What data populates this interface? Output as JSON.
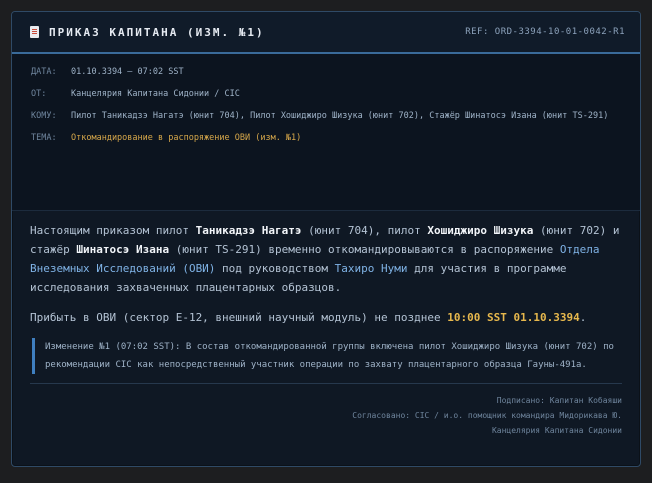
{
  "header": {
    "icon": "document-icon",
    "title": "ПРИКАЗ КАПИТАНА (ИЗМ. №1)",
    "ref": "REF: ORD-3394-10-01-0042-R1"
  },
  "meta": {
    "date_key": "ДАТА:",
    "date_val": "01.10.3394 — 07:02 SST",
    "from_key": "ОТ:",
    "from_val": "Канцелярия Капитана Сидонии / CIC",
    "to_key": "КОМУ:",
    "to_val": "Пилот Таникадзэ Нагатэ (юнит 704), Пилот Хошиджиро Шизука (юнит 702), Стажёр Шинатосэ Изана (юнит TS-291)",
    "topic_key": "ТЕМА:",
    "topic_val": "Откомандирование в распоряжение ОВИ (изм. №1)"
  },
  "body": {
    "p1": {
      "t1": "Настоящим приказом пилот ",
      "n1": "Таникадзэ Нагатэ",
      "t2": " (юнит 704), пилот ",
      "n2": "Хошиджиро Шизука",
      "t3": " (юнит 702) и стажёр ",
      "n3": "Шинатосэ Изана",
      "t4": " (юнит TS-291) временно откомандировываются в распоряжение ",
      "org": "Отдела Внеземных Исследований (ОВИ)",
      "t5": " под руководством ",
      "chief": "Тахиро Нуми",
      "t6": " для участия в программе исследования захваченных плацентарных образцов."
    },
    "p2": {
      "t1": "Прибыть в ОВИ (сектор E-12, внешний научный модуль) не позднее ",
      "time": "10:00 SST 01.10.3394",
      "t2": "."
    },
    "amendment": "Изменение №1 (07:02 SST): В состав откомандированной группы включена пилот Хошиджиро Шизука (юнит 702) по рекомендации CIC как непосредственный участник операции по захвату плацентарного образца Гауны-491а."
  },
  "signature": {
    "line1": "Подписано: Капитан Кобаяши",
    "line2": "Согласовано: CIC / и.о. помощник командира Мидорикава Ю.",
    "line3": "Канцелярия Капитана Сидонии"
  },
  "colors": {
    "background": "#1d1e20",
    "panel": "#0f1824",
    "accent": "#3a6b9a",
    "highlight": "#7fb2e5",
    "topic": "#d6a74a",
    "time": "#e7b84d"
  }
}
